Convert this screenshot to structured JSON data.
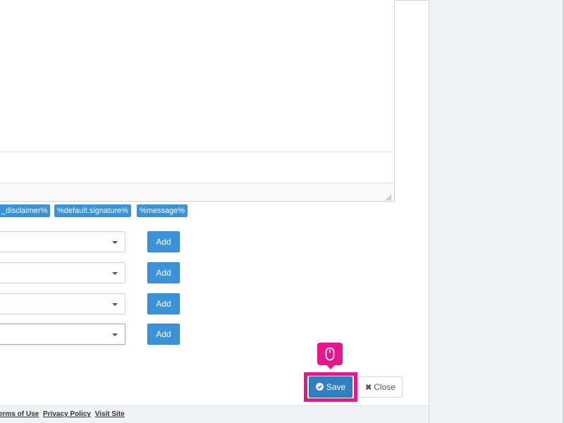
{
  "editor": {
    "content": ""
  },
  "placeholders": {
    "tags": [
      "_disclaimer%",
      "%default.signature%",
      "%message%"
    ]
  },
  "recipient_rows": [
    {
      "selected": "",
      "add_label": "Add"
    },
    {
      "selected": "",
      "add_label": "Add"
    },
    {
      "selected": "",
      "add_label": "Add"
    },
    {
      "selected": "",
      "add_label": "Add"
    }
  ],
  "actions": {
    "save_label": "Save",
    "close_label": "Close"
  },
  "footer": {
    "links": [
      "erms of Use",
      "Privacy Policy",
      "Visit Site"
    ]
  },
  "colors": {
    "accent": "#3a92d8",
    "save": "#2f7fc1",
    "highlight": "#e5168e"
  },
  "icons": {
    "save": "check-circle-icon",
    "close": "close-icon",
    "pointer": "mouse-icon"
  }
}
